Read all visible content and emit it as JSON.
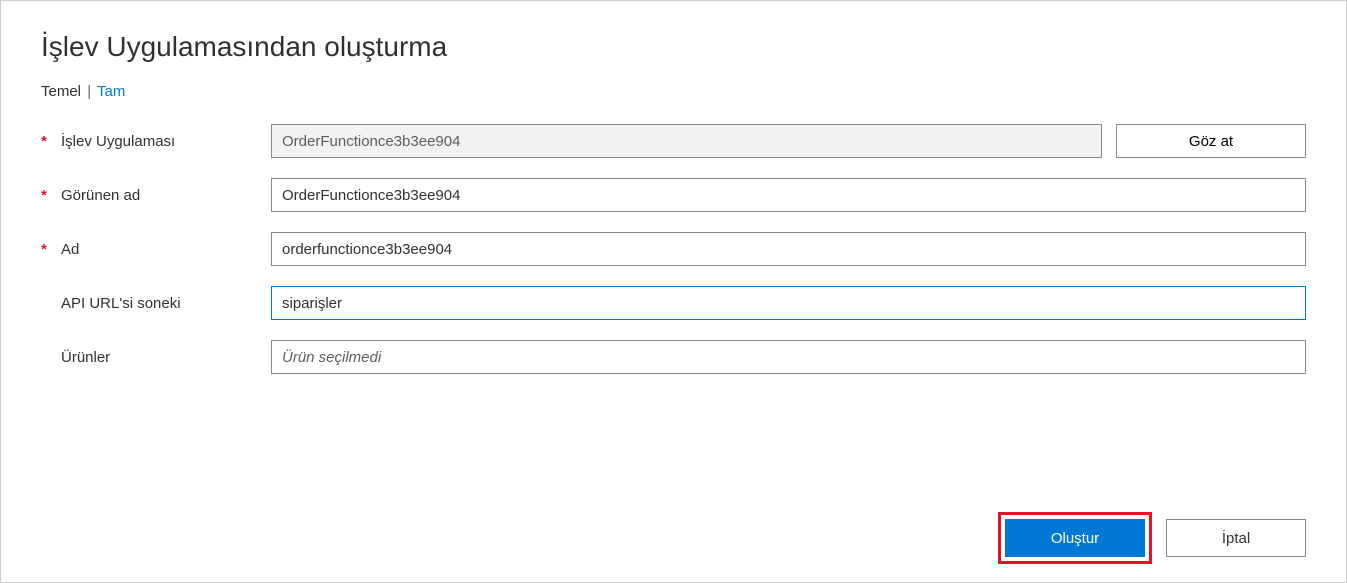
{
  "header": {
    "title": "İşlev Uygulamasından oluşturma"
  },
  "tabs": {
    "basic": "Temel",
    "full": "Tam",
    "separator": "|"
  },
  "form": {
    "function_app": {
      "label": "İşlev Uygulaması",
      "value": "OrderFunctionce3b3ee904",
      "browse_label": "Göz at"
    },
    "display_name": {
      "label": "Görünen ad",
      "value": "OrderFunctionce3b3ee904"
    },
    "name": {
      "label": "Ad",
      "value": "orderfunctionce3b3ee904"
    },
    "api_suffix": {
      "label": "API URL'si soneki",
      "value": "siparişler"
    },
    "products": {
      "label": "Ürünler",
      "placeholder": "Ürün seçilmedi",
      "value": ""
    }
  },
  "footer": {
    "create_label": "Oluştur",
    "cancel_label": "İptal"
  }
}
